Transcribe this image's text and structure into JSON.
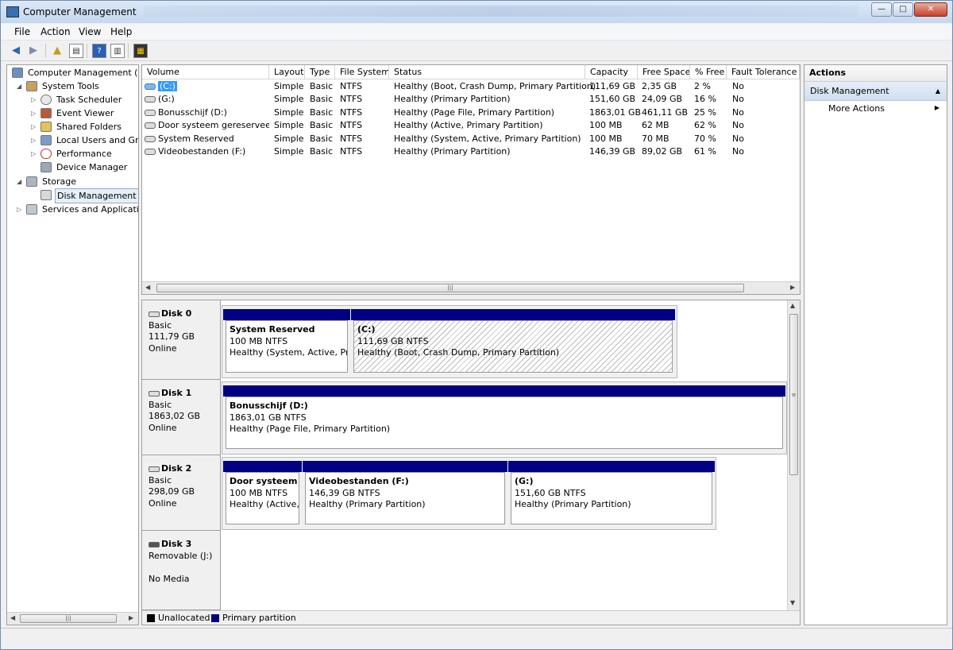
{
  "window": {
    "title": "Computer Management",
    "min": "—",
    "max": "□",
    "close": "✕"
  },
  "menu": [
    "File",
    "Action",
    "View",
    "Help"
  ],
  "tree": {
    "root": "Computer Management (Local)",
    "system_tools": "System Tools",
    "task_scheduler": "Task Scheduler",
    "event_viewer": "Event Viewer",
    "shared_folders": "Shared Folders",
    "local_users": "Local Users and Groups",
    "performance": "Performance",
    "device_manager": "Device Manager",
    "storage": "Storage",
    "disk_management": "Disk Management",
    "services": "Services and Applications"
  },
  "volume_table": {
    "headers": [
      "Volume",
      "Layout",
      "Type",
      "File System",
      "Status",
      "Capacity",
      "Free Space",
      "% Free",
      "Fault Tolerance"
    ],
    "rows": [
      [
        "(C:)",
        "Simple",
        "Basic",
        "NTFS",
        "Healthy (Boot, Crash Dump, Primary Partition)",
        "111,69 GB",
        "2,35 GB",
        "2 %",
        "No"
      ],
      [
        "(G:)",
        "Simple",
        "Basic",
        "NTFS",
        "Healthy (Primary Partition)",
        "151,60 GB",
        "24,09 GB",
        "16 %",
        "No"
      ],
      [
        "Bonusschijf (D:)",
        "Simple",
        "Basic",
        "NTFS",
        "Healthy (Page File, Primary Partition)",
        "1863,01 GB",
        "461,11 GB",
        "25 %",
        "No"
      ],
      [
        "Door systeem gereserveerd",
        "Simple",
        "Basic",
        "NTFS",
        "Healthy (Active, Primary Partition)",
        "100 MB",
        "62 MB",
        "62 %",
        "No"
      ],
      [
        "System Reserved",
        "Simple",
        "Basic",
        "NTFS",
        "Healthy (System, Active, Primary Partition)",
        "100 MB",
        "70 MB",
        "70 %",
        "No"
      ],
      [
        "Videobestanden (F:)",
        "Simple",
        "Basic",
        "NTFS",
        "Healthy (Primary Partition)",
        "146,39 GB",
        "89,02 GB",
        "61 %",
        "No"
      ]
    ]
  },
  "disks": [
    {
      "name": "Disk 0",
      "type": "Basic",
      "size": "111,79 GB",
      "state": "Online",
      "partitions": [
        {
          "name": "System Reserved",
          "size": "100 MB NTFS",
          "status": "Healthy (System, Active, Prin"
        },
        {
          "name": "(C:)",
          "size": "111,69 GB NTFS",
          "status": "Healthy (Boot, Crash Dump, Primary Partition)"
        }
      ]
    },
    {
      "name": "Disk 1",
      "type": "Basic",
      "size": "1863,02 GB",
      "state": "Online",
      "partitions": [
        {
          "name": "Bonusschijf  (D:)",
          "size": "1863,01 GB NTFS",
          "status": "Healthy (Page File, Primary Partition)"
        }
      ]
    },
    {
      "name": "Disk 2",
      "type": "Basic",
      "size": "298,09 GB",
      "state": "Online",
      "partitions": [
        {
          "name": "Door systeem g",
          "size": "100 MB NTFS",
          "status": "Healthy (Active,"
        },
        {
          "name": "Videobestanden  (F:)",
          "size": "146,39 GB NTFS",
          "status": "Healthy (Primary Partition)"
        },
        {
          "name": "(G:)",
          "size": "151,60 GB NTFS",
          "status": "Healthy (Primary Partition)"
        }
      ]
    },
    {
      "name": "Disk 3",
      "type": "Removable (J:)",
      "state": "No Media"
    }
  ],
  "legend": {
    "unallocated": "Unallocated",
    "primary": "Primary partition",
    "unallocated_color": "#000000",
    "primary_color": "#000080"
  },
  "actions": {
    "header": "Actions",
    "section": "Disk Management",
    "more": "More Actions"
  }
}
